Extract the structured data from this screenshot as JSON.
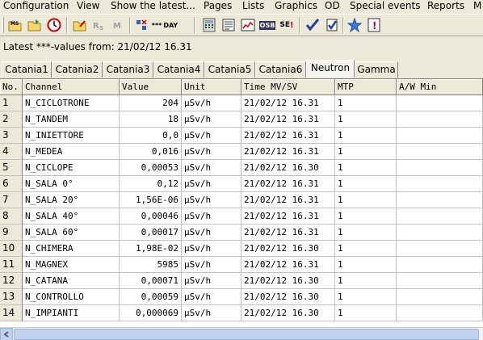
{
  "menu": [
    "Configuration",
    "View",
    "Show the latest...",
    "Pages",
    "Lists",
    "Graphics",
    "OD",
    "Special events",
    "Reports",
    "M"
  ],
  "toolbar": {
    "day_label": "DAY",
    "dots_label": "***",
    "osb_label": "OSB",
    "se_label": "SE"
  },
  "latest_text": "Latest ***-values from: 21/02/12 16.31",
  "tabs": [
    "Catania1",
    "Catania2",
    "Catania3",
    "Catania4",
    "Catania5",
    "Catania6",
    "Neutron",
    "Gamma"
  ],
  "active_tab": "Neutron",
  "columns": [
    "No.",
    "Channel",
    "Value",
    "Unit",
    "Time MV/SV",
    "MTP",
    "A/W Min"
  ],
  "rows": [
    [
      "1",
      "N_CICLOTRONE",
      "204",
      "µSv/h",
      "21/02/12 16.31",
      "1",
      ""
    ],
    [
      "2",
      "N_TANDEM",
      "18",
      "µSv/h",
      "21/02/12 16.31",
      "1",
      ""
    ],
    [
      "3",
      "N_INIETTORE",
      "0,0",
      "µSv/h",
      "21/02/12 16.31",
      "1",
      ""
    ],
    [
      "4",
      "N_MEDEA",
      "0,016",
      "µSv/h",
      "21/02/12 16.31",
      "1",
      ""
    ],
    [
      "5",
      "N_CICLOPE",
      "0,00053",
      "µSv/h",
      "21/02/12 16.30",
      "1",
      ""
    ],
    [
      "6",
      "N_SALA 0°",
      "0,12",
      "µSv/h",
      "21/02/12 16.31",
      "1",
      ""
    ],
    [
      "7",
      "N_SALA 20°",
      "1,56E-06",
      "µSv/h",
      "21/02/12 16.31",
      "1",
      ""
    ],
    [
      "8",
      "N_SALA 40°",
      "0,00046",
      "µSv/h",
      "21/02/12 16.31",
      "1",
      ""
    ],
    [
      "9",
      "N_SALA 60°",
      "0,00017",
      "µSv/h",
      "21/02/12 16.31",
      "1",
      ""
    ],
    [
      "10",
      "N_CHIMERA",
      "1,98E-02",
      "µSv/h",
      "21/02/12 16.30",
      "1",
      ""
    ],
    [
      "11",
      "N_MAGNEX",
      "5985",
      "µSv/h",
      "21/02/12 16.31",
      "1",
      ""
    ],
    [
      "12",
      "N_CATANA",
      "0,00071",
      "µSv/h",
      "21/02/12 16.30",
      "1",
      ""
    ],
    [
      "13",
      "N_CONTROLLO",
      "0,00059",
      "µSv/h",
      "21/02/12 16.30",
      "1",
      ""
    ],
    [
      "14",
      "N_IMPIANTI",
      "0,000069",
      "µSv/h",
      "21/02/12 16.30",
      "1",
      ""
    ]
  ],
  "colors": {
    "background": "#ece9d8",
    "grid_bg": "#ffffff",
    "scroll_blue": "#c1d2ee"
  }
}
